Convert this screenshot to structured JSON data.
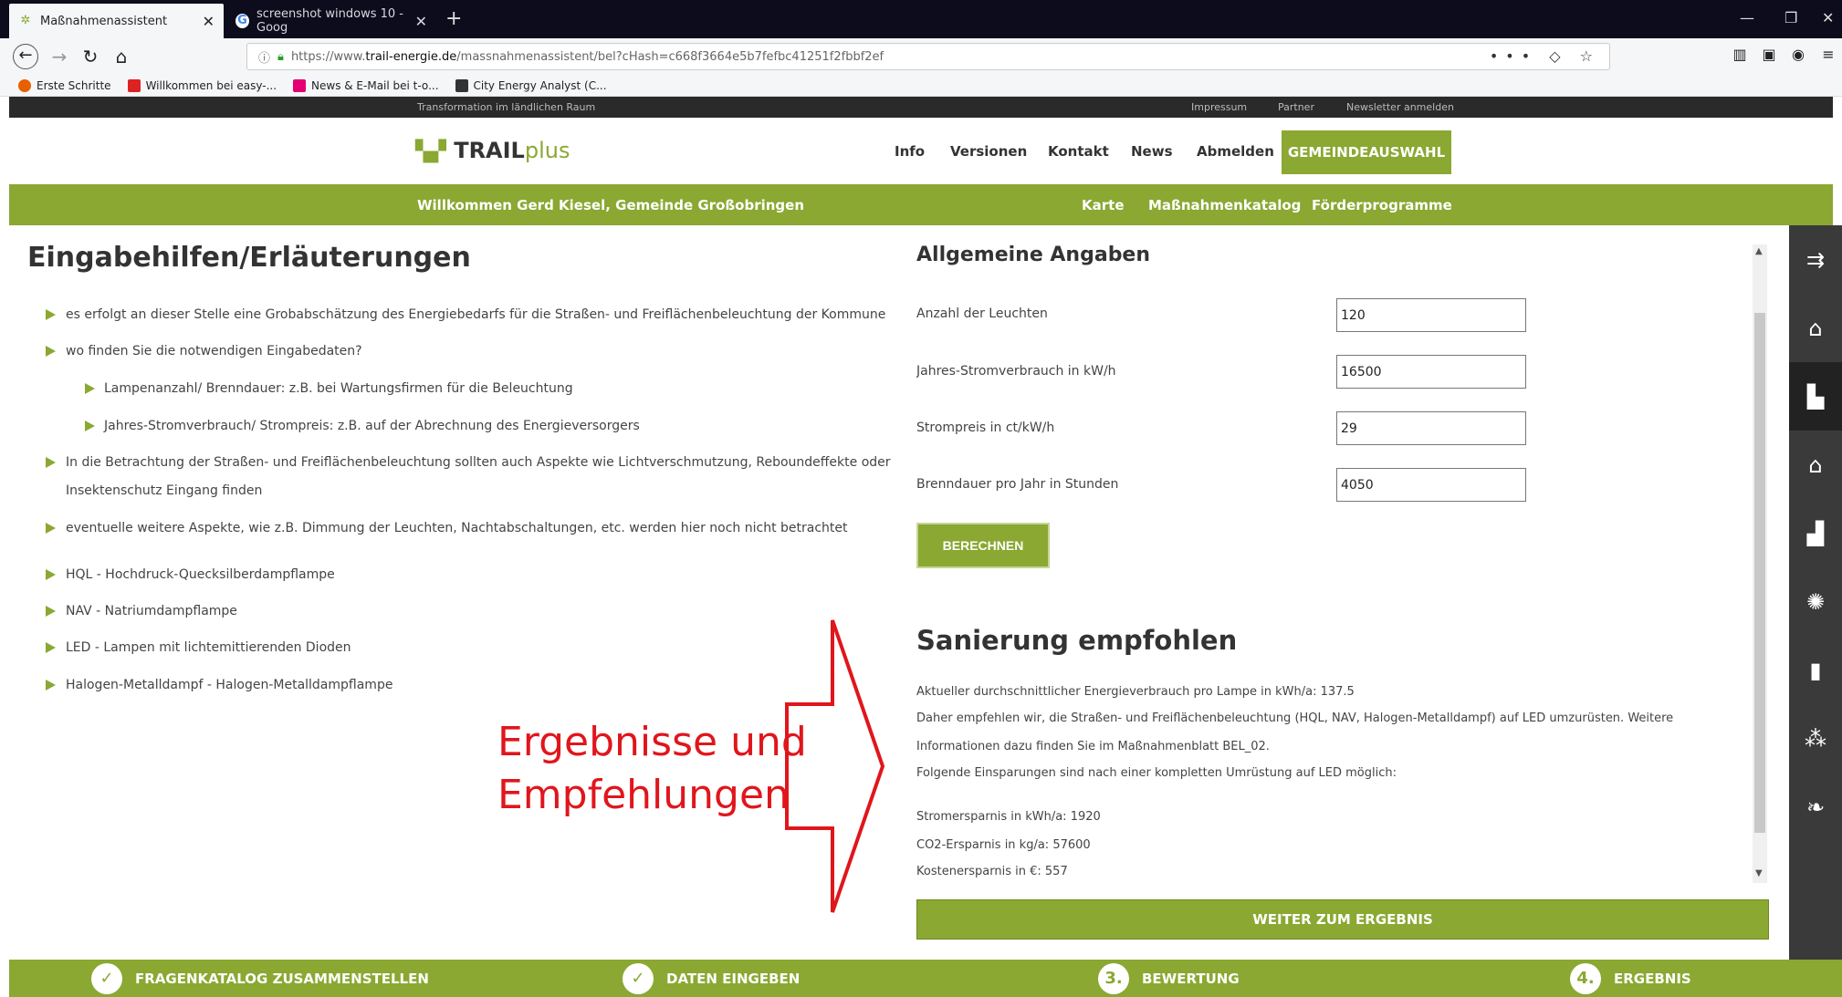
{
  "browser": {
    "tabs": [
      {
        "label": "Maßnahmenassistent",
        "icon": "leaf-icon",
        "active": true
      },
      {
        "label": "screenshot windows 10 - Goog",
        "icon": "google-icon",
        "active": false
      }
    ],
    "url_prefix": "https://www.",
    "url_domain": "trail-energie.de",
    "url_path": "/massnahmenassistent/bel?cHash=c668f3664e5b7fefbc41251f2fbbf2ef",
    "bookmarks": [
      {
        "label": "Erste Schritte",
        "color": "#e66000"
      },
      {
        "label": "Willkommen bei easy-...",
        "color": "#d22"
      },
      {
        "label": "News & E-Mail bei t-o...",
        "color": "#e20074"
      },
      {
        "label": "City Energy Analyst (C...",
        "color": "#333"
      }
    ]
  },
  "topbar": {
    "tagline": "Transformation im ländlichen Raum",
    "links": [
      "Impressum",
      "Partner",
      "Newsletter anmelden"
    ]
  },
  "header": {
    "logo_main": "TRAIL",
    "logo_plus": "plus",
    "nav": [
      "Info",
      "Versionen",
      "Kontakt",
      "News",
      "Abmelden"
    ],
    "cta": "GEMEINDEAUSWAHL"
  },
  "greenbar": {
    "welcome": "Willkommen Gerd Kiesel, Gemeinde Großobringen",
    "links": [
      "Karte",
      "Maßnahmenkatalog",
      "Förderprogramme"
    ]
  },
  "left": {
    "title": "Eingabehilfen/Erläuterungen",
    "items": [
      "es erfolgt an dieser Stelle eine Grobabschätzung des Energiebedarfs für die Straßen- und Freiflächenbeleuchtung der Kommune",
      "wo finden Sie die notwendigen Eingabedaten?",
      "Lampenanzahl/ Brenndauer: z.B. bei Wartungsfirmen für die Beleuchtung",
      "Jahres-Stromverbrauch/ Strompreis: z.B. auf der Abrechnung des Energieversorgers",
      "In die Betrachtung der Straßen- und Freiflächenbeleuchtung sollten auch Aspekte wie Lichtverschmutzung, Reboundeffekte oder",
      "Insektenschutz Eingang finden",
      "eventuelle weitere Aspekte, wie z.B. Dimmung der Leuchten, Nachtabschaltungen, etc. werden hier noch nicht betrachtet",
      "HQL - Hochdruck-Quecksilberdampflampe",
      "NAV - Natriumdampflampe",
      "LED - Lampen mit lichtemittierenden Dioden",
      "Halogen-Metalldampf - Halogen-Metalldampflampe"
    ]
  },
  "form": {
    "title": "Allgemeine Angaben",
    "fields": [
      {
        "label": "Anzahl der Leuchten",
        "value": "120"
      },
      {
        "label": "Jahres-Stromverbrauch in kW/h",
        "value": "16500"
      },
      {
        "label": "Strompreis in ct/kW/h",
        "value": "29"
      },
      {
        "label": "Brenndauer pro Jahr in Stunden",
        "value": "4050"
      }
    ],
    "button": "BERECHNEN"
  },
  "result": {
    "title": "Sanierung empfohlen",
    "lines": [
      "Aktueller durchschnittlicher Energieverbrauch pro Lampe in kWh/a: 137.5",
      "Daher empfehlen wir, die Straßen- und Freiflächenbeleuchtung (HQL, NAV, Halogen-Metalldampf) auf LED umzurüsten. Weitere",
      "Informationen dazu finden Sie im Maßnahmenblatt BEL_02.",
      "Folgende Einsparungen sind nach einer kompletten Umrüstung auf LED möglich:",
      "Stromersparnis in kWh/a: 1920",
      "CO2-Ersparnis in kg/a: 57600",
      "Kostenersparnis in €: 557"
    ],
    "next_button": "WEITER ZUM ERGEBNIS"
  },
  "steps": [
    {
      "marker": "✓",
      "label": "FRAGENKATALOG ZUSAMMENSTELLEN"
    },
    {
      "marker": "✓",
      "label": "DATEN EINGEBEN"
    },
    {
      "marker": "3.",
      "label": "BEWERTUNG"
    },
    {
      "marker": "4.",
      "label": "ERGEBNIS"
    }
  ],
  "annotation": {
    "line1": "Ergebnisse und",
    "line2": "Empfehlungen",
    "color": "#e0161c"
  }
}
